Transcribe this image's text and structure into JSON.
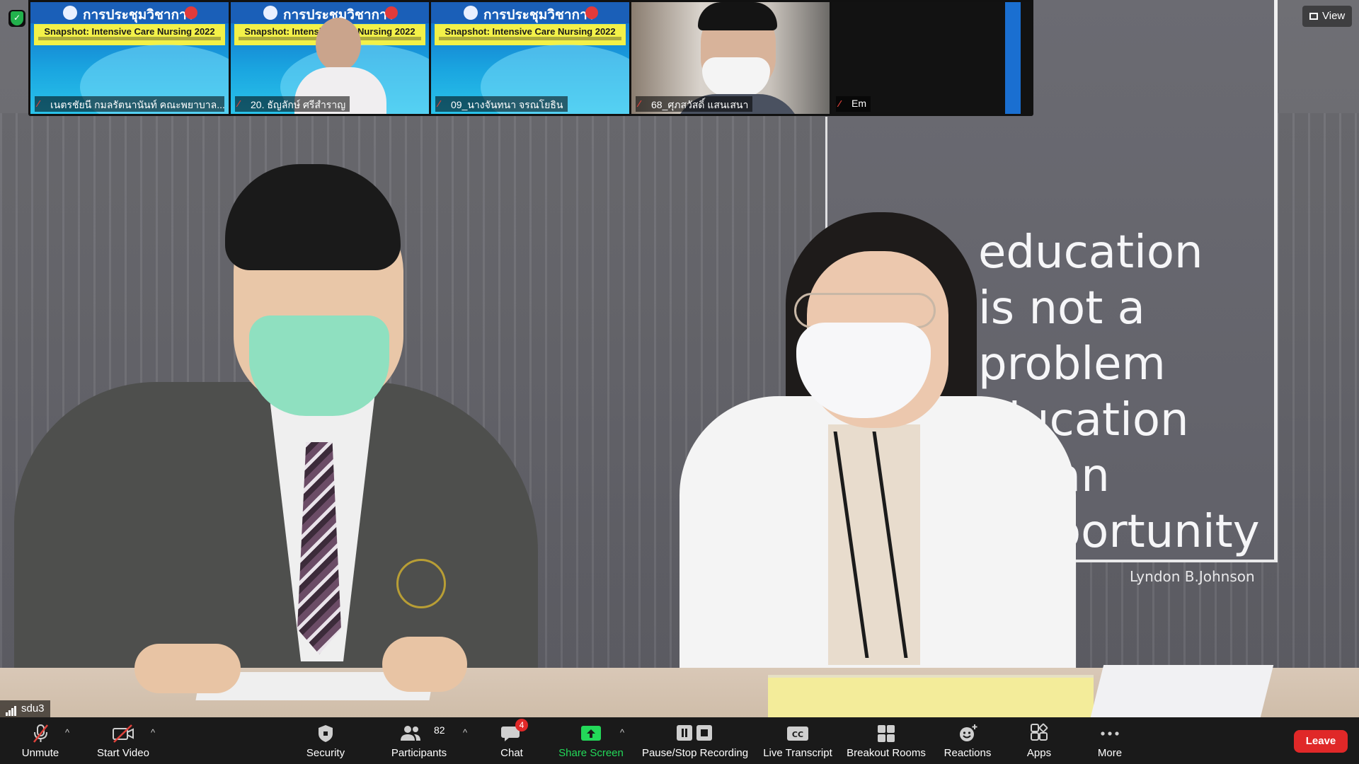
{
  "meeting": {
    "view_label": "View",
    "network_label": "sdu3"
  },
  "thumbnails": [
    {
      "name": "เนตรชัยนี กมลรัตนานันท์ คณะพยาบาล...",
      "kind": "slide"
    },
    {
      "name": "20. ธัญลักษ์ ศรีสำราญ",
      "kind": "slide-person"
    },
    {
      "name": "09_นางจันทนา จรณโยธิน",
      "kind": "slide"
    },
    {
      "name": "68_ศุภสวัสดิ์ แสนเสนา",
      "kind": "camera"
    },
    {
      "name": "Em",
      "kind": "black"
    }
  ],
  "slide": {
    "title": "การประชุมวิชาการ",
    "subtitle": "Snapshot: Intensive Care Nursing 2022"
  },
  "quote": {
    "lines": [
      "education",
      "is  not  a",
      "problem",
      "education",
      "an",
      "oortunity"
    ],
    "author": "Lyndon B.Johnson"
  },
  "toolbar": {
    "unmute": "Unmute",
    "start_video": "Start Video",
    "security": "Security",
    "participants": "Participants",
    "participants_count": "82",
    "chat": "Chat",
    "chat_badge": "4",
    "share_screen": "Share Screen",
    "recording": "Pause/Stop Recording",
    "live_transcript": "Live Transcript",
    "breakout_rooms": "Breakout Rooms",
    "reactions": "Reactions",
    "apps": "Apps",
    "more": "More",
    "leave": "Leave"
  },
  "colors": {
    "toolbar_bg": "#1a1a1a",
    "share_green": "#23d959",
    "leave_red": "#e02828",
    "mic_muted_red": "#e0423b"
  }
}
